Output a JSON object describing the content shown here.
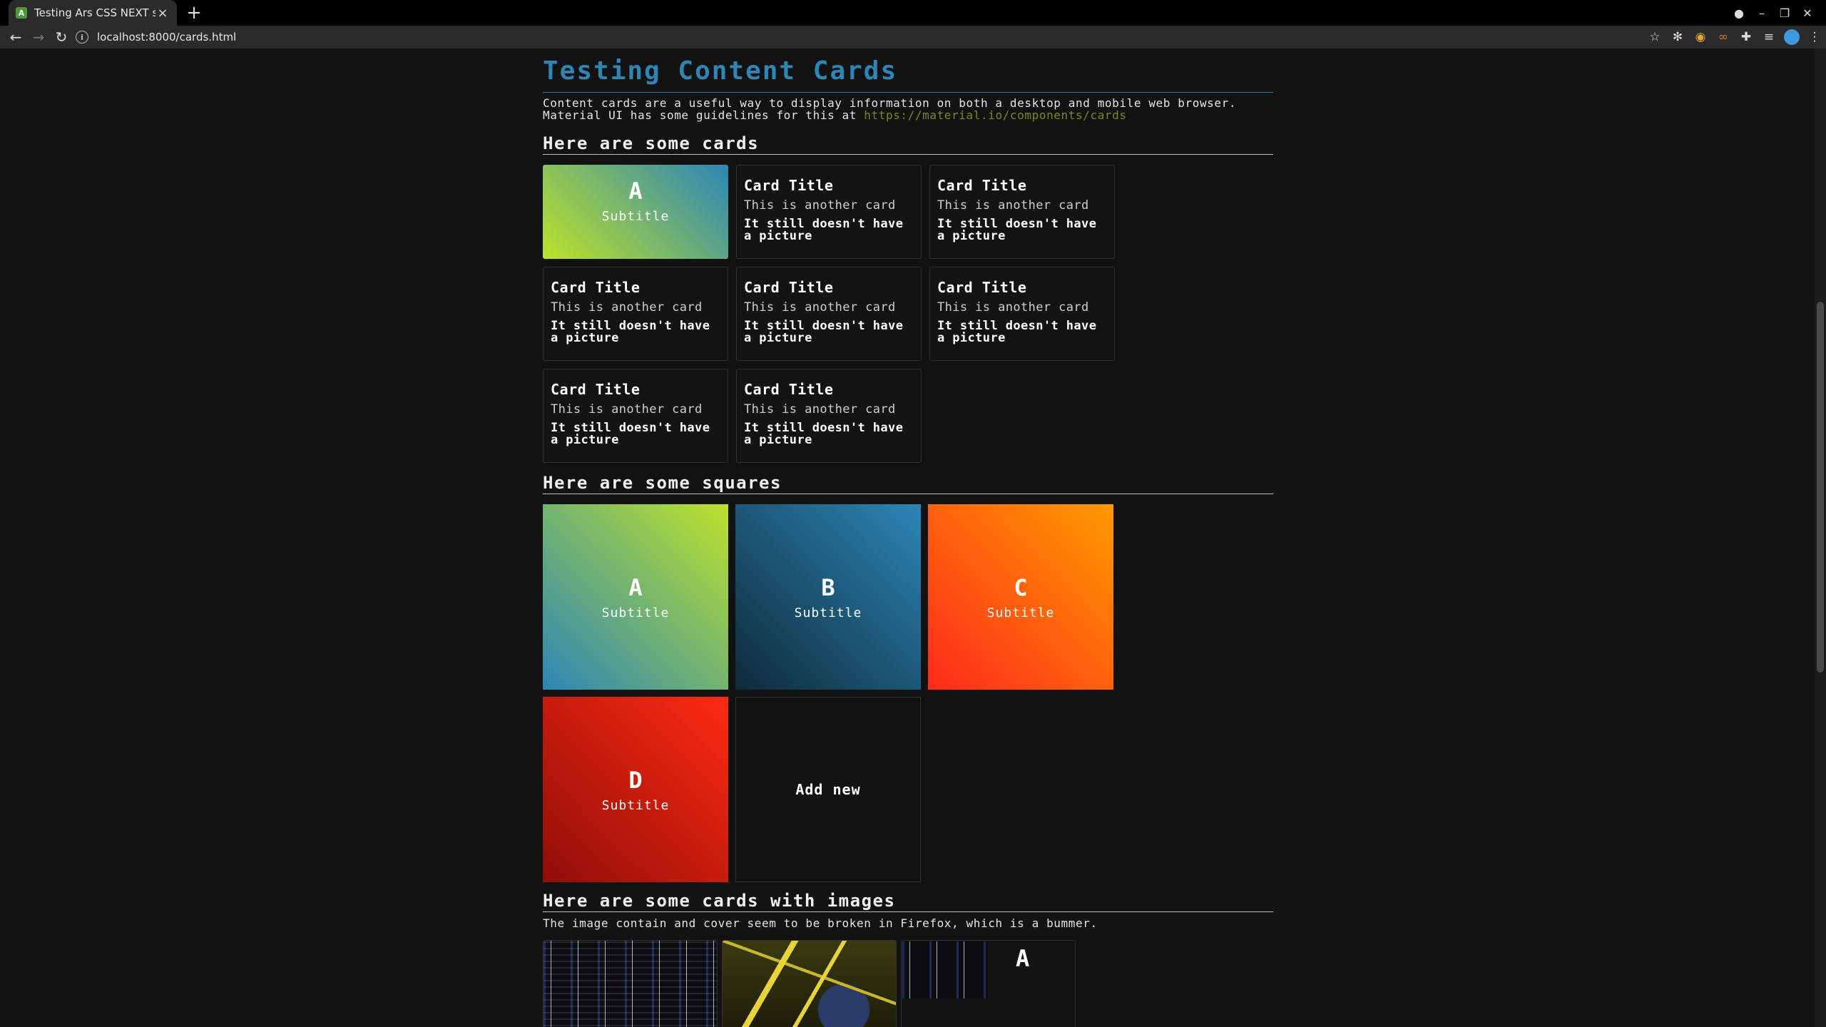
{
  "browser": {
    "tab_title": "Testing Ars CSS NEXT styling",
    "url": "localhost:8000/cards.html"
  },
  "page": {
    "title": "Testing Content Cards",
    "intro_text": "Content cards are a useful way to display information on both a desktop and mobile web browser. Material UI has some guidelines for this at ",
    "intro_link": "https://material.io/components/cards"
  },
  "cards_section": {
    "heading": "Here are some cards",
    "gradient_card": {
      "letter": "A",
      "subtitle": "Subtitle"
    },
    "cards": [
      {
        "title": "Card Title",
        "subtitle": "This is another card",
        "body": "It still doesn't have a picture"
      },
      {
        "title": "Card Title",
        "subtitle": "This is another card",
        "body": "It still doesn't have a picture"
      },
      {
        "title": "Card Title",
        "subtitle": "This is another card",
        "body": "It still doesn't have a picture"
      },
      {
        "title": "Card Title",
        "subtitle": "This is another card",
        "body": "It still doesn't have a picture"
      },
      {
        "title": "Card Title",
        "subtitle": "This is another card",
        "body": "It still doesn't have a picture"
      },
      {
        "title": "Card Title",
        "subtitle": "This is another card",
        "body": "It still doesn't have a picture"
      },
      {
        "title": "Card Title",
        "subtitle": "This is another card",
        "body": "It still doesn't have a picture"
      }
    ]
  },
  "squares_section": {
    "heading": "Here are some squares",
    "squares": [
      {
        "letter": "A",
        "subtitle": "Subtitle"
      },
      {
        "letter": "B",
        "subtitle": "Subtitle"
      },
      {
        "letter": "C",
        "subtitle": "Subtitle"
      },
      {
        "letter": "D",
        "subtitle": "Subtitle"
      }
    ],
    "add_new": "Add new"
  },
  "images_section": {
    "heading": "Here are some cards with images",
    "note": "The image contain and cover seem to be broken in Firefox, which is a bummer.",
    "third_card_letter": "A"
  },
  "colors": {
    "accent": "#2c86b6",
    "link": "#6f8f1c",
    "background": "#121212"
  }
}
